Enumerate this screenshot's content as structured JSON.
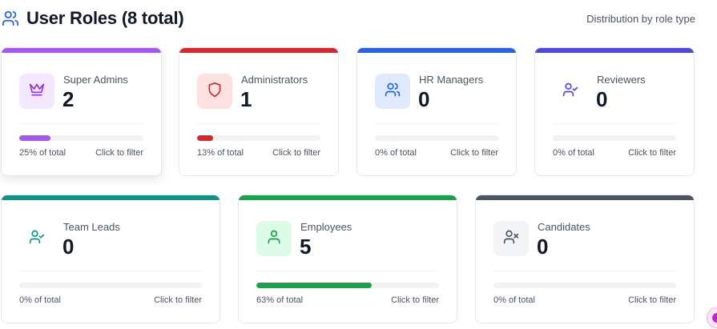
{
  "header": {
    "title": "User Roles (8 total)",
    "subtitle": "Distribution by role type",
    "icon": "users-icon"
  },
  "accent_color": "#2563eb",
  "cards": [
    {
      "label": "Super Admins",
      "count": "2",
      "percent_text": "25% of total",
      "percent": 25,
      "filter_text": "Click to filter",
      "color": "#a855f7",
      "icon_bg": "#f3e8ff",
      "icon": "crown-icon"
    },
    {
      "label": "Administrators",
      "count": "1",
      "percent_text": "13% of total",
      "percent": 13,
      "filter_text": "Click to filter",
      "color": "#dc2626",
      "icon_bg": "#fee2e2",
      "icon": "shield-icon"
    },
    {
      "label": "HR Managers",
      "count": "0",
      "percent_text": "0% of total",
      "percent": 0,
      "filter_text": "Click to filter",
      "color": "#2563eb",
      "icon_bg": "#e0eaff",
      "icon": "users-icon"
    },
    {
      "label": "Reviewers",
      "count": "0",
      "percent_text": "0% of total",
      "percent": 0,
      "filter_text": "Click to filter",
      "color": "#4f46e5",
      "icon_bg": "#ffffff",
      "icon": "user-check-icon"
    },
    {
      "label": "Team Leads",
      "count": "0",
      "percent_text": "0% of total",
      "percent": 0,
      "filter_text": "Click to filter",
      "color": "#0d9488",
      "icon_bg": "#ffffff",
      "icon": "user-check-icon"
    },
    {
      "label": "Employees",
      "count": "5",
      "percent_text": "63% of total",
      "percent": 63,
      "filter_text": "Click to filter",
      "color": "#16a34a",
      "icon_bg": "#dcfce7",
      "icon": "user-icon"
    },
    {
      "label": "Candidates",
      "count": "0",
      "percent_text": "0% of total",
      "percent": 0,
      "filter_text": "Click to filter",
      "color": "#4b5563",
      "icon_bg": "#f3f4f6",
      "icon": "user-x-icon"
    }
  ]
}
